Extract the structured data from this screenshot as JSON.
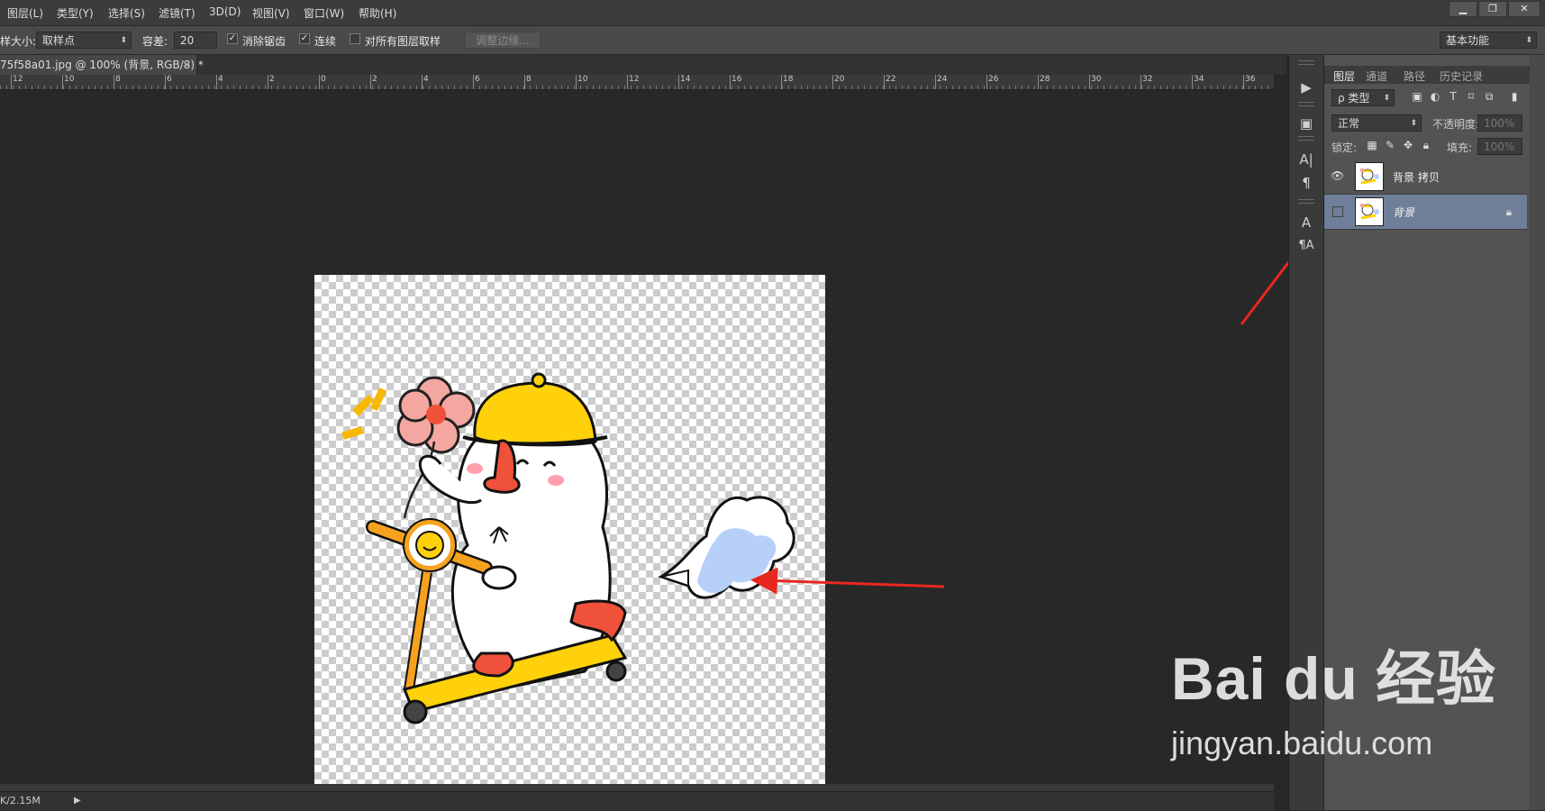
{
  "menu": {
    "items": [
      "图层(L)",
      "类型(Y)",
      "选择(S)",
      "滤镜(T)",
      "3D(D)",
      "视图(V)",
      "窗口(W)",
      "帮助(H)"
    ],
    "window_buttons": [
      "▁",
      "❐",
      "✕"
    ]
  },
  "options": {
    "sample_size_label": "样大小:",
    "sample_size_value": "取样点",
    "tolerance_label": "容差:",
    "tolerance_value": "20",
    "antialias_label": "消除锯齿",
    "antialias_checked": true,
    "contiguous_label": "连续",
    "contiguous_checked": true,
    "all_layers_label": "对所有图层取样",
    "all_layers_checked": false,
    "refine_edge_label": "调整边缘...",
    "workspace_label": "基本功能"
  },
  "document": {
    "tab_title": "75f58a01.jpg @ 100% (背景, RGB/8) *",
    "close_glyph": "×"
  },
  "ruler": {
    "labels": [
      "12",
      "10",
      "8",
      "6",
      "4",
      "2",
      "0",
      "2",
      "4",
      "6",
      "8",
      "10",
      "12",
      "14",
      "16",
      "18",
      "20",
      "22",
      "24",
      "26",
      "28",
      "30",
      "32",
      "34",
      "36"
    ]
  },
  "status": {
    "doc_size": "K/2.15M",
    "arrow": "▶"
  },
  "tools": {
    "icons": [
      "play-icon",
      "brush-settings-icon",
      "character-icon",
      "paragraph-icon",
      "character-style-icon",
      "paragraph-style-icon"
    ],
    "glyphs": [
      "▶",
      "▣",
      "A|",
      "¶",
      "A",
      "¶A"
    ]
  },
  "layers_panel": {
    "tabs": [
      "图层",
      "通道",
      "路径",
      "历史记录"
    ],
    "filter_label": "ρ 类型",
    "blend_mode": "正常",
    "opacity_label": "不透明度:",
    "opacity_value": "100%",
    "lock_label": "锁定:",
    "fill_label": "填充:",
    "fill_value": "100%",
    "layers": [
      {
        "name": "背景 拷贝",
        "visible": true,
        "selected": false,
        "locked": false
      },
      {
        "name": "背景",
        "visible": false,
        "selected": true,
        "locked": true
      }
    ]
  },
  "watermark": {
    "logo": "Bai du 经验",
    "url": "jingyan.baidu.com"
  },
  "colors": {
    "selected_layer": "#6f7f99",
    "annotation_arrow": "#e8271f"
  }
}
